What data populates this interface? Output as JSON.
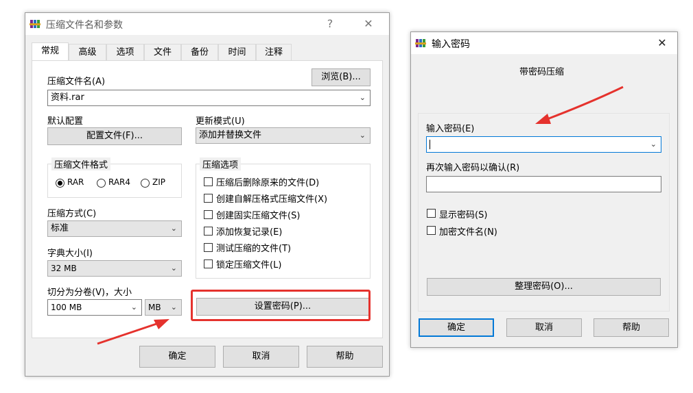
{
  "left_dialog": {
    "title": "压缩文件名和参数",
    "help_btn": "?",
    "close_btn": "✕",
    "tabs": [
      "常规",
      "高级",
      "选项",
      "文件",
      "备份",
      "时间",
      "注释"
    ],
    "archive_name_label": "压缩文件名(A)",
    "browse_button": "浏览(B)...",
    "archive_name_value": "资料.rar",
    "default_profile_label": "默认配置",
    "profile_button": "配置文件(F)...",
    "update_mode_label": "更新模式(U)",
    "update_mode_value": "添加并替换文件",
    "format_group_title": "压缩文件格式",
    "formats": [
      {
        "label": "RAR",
        "selected": true
      },
      {
        "label": "RAR4",
        "selected": false
      },
      {
        "label": "ZIP",
        "selected": false
      }
    ],
    "options_group_title": "压缩选项",
    "options": [
      "压缩后删除原来的文件(D)",
      "创建自解压格式压缩文件(X)",
      "创建固实压缩文件(S)",
      "添加恢复记录(E)",
      "测试压缩的文件(T)",
      "锁定压缩文件(L)"
    ],
    "method_label": "压缩方式(C)",
    "method_value": "标准",
    "dict_label": "字典大小(I)",
    "dict_value": "32 MB",
    "split_label": "切分为分卷(V)，大小",
    "split_value": "100 MB",
    "split_unit": "MB",
    "set_password_button": "设置密码(P)...",
    "ok_button": "确定",
    "cancel_button": "取消",
    "help_button": "帮助"
  },
  "right_dialog": {
    "title": "输入密码",
    "close_btn": "✕",
    "heading": "带密码压缩",
    "enter_password_label": "输入密码(E)",
    "enter_password_value": "",
    "reenter_label": "再次输入密码以确认(R)",
    "show_password_label": "显示密码(S)",
    "encrypt_names_label": "加密文件名(N)",
    "organize_button": "整理密码(O)...",
    "ok_button": "确定",
    "cancel_button": "取消",
    "help_button": "帮助"
  },
  "colors": {
    "highlight_box": "#e5322d",
    "arrow": "#e5322d",
    "focus_border": "#0078d7"
  }
}
